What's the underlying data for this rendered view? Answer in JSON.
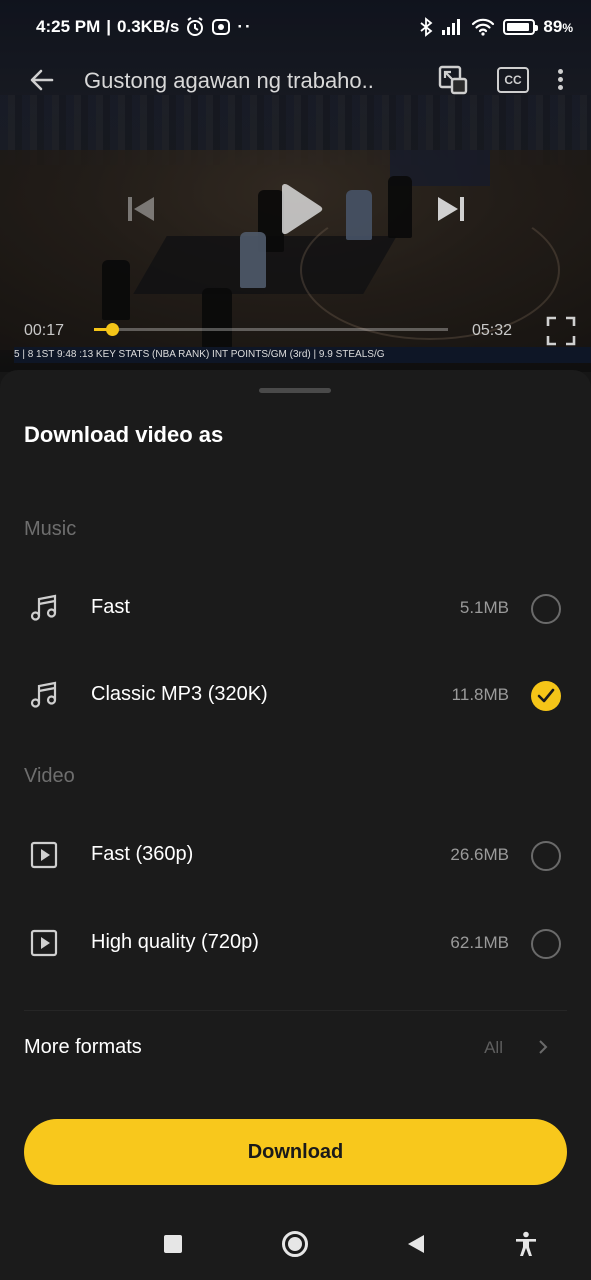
{
  "status_bar": {
    "time": "4:25 PM",
    "speed": "0.3KB/s",
    "battery": "89",
    "battery_unit": "%",
    "battery_level": 0.89
  },
  "video": {
    "title": "Gustong agawan ng trabaho..",
    "cc_label": "CC",
    "current_time": "00:17",
    "total_time": "05:32",
    "progress_fraction": 0.052,
    "scorebug_text": "5  |  8  1ST  9:48  :13  KEY STATS (NBA RANK) INT POINTS/GM (3rd) | 9.9 STEALS/G"
  },
  "sheet": {
    "title": "Download video as",
    "music_section": "Music",
    "video_section": "Video",
    "music_options": [
      {
        "label": "Fast",
        "size": "5.1MB",
        "selected": false,
        "icon": "music-note-icon"
      },
      {
        "label": "Classic MP3 (320K)",
        "size": "11.8MB",
        "selected": true,
        "icon": "music-note-icon"
      }
    ],
    "video_options": [
      {
        "label": "Fast (360p)",
        "size": "26.6MB",
        "selected": false,
        "icon": "play-square-icon"
      },
      {
        "label": "High quality (720p)",
        "size": "62.1MB",
        "selected": false,
        "icon": "play-square-icon"
      }
    ],
    "more_formats_label": "More formats",
    "more_formats_value": "All",
    "download_label": "Download"
  },
  "colors": {
    "accent": "#f8c81c",
    "sheet_bg": "#1b1b1b",
    "muted_text": "#6e6e6e"
  }
}
